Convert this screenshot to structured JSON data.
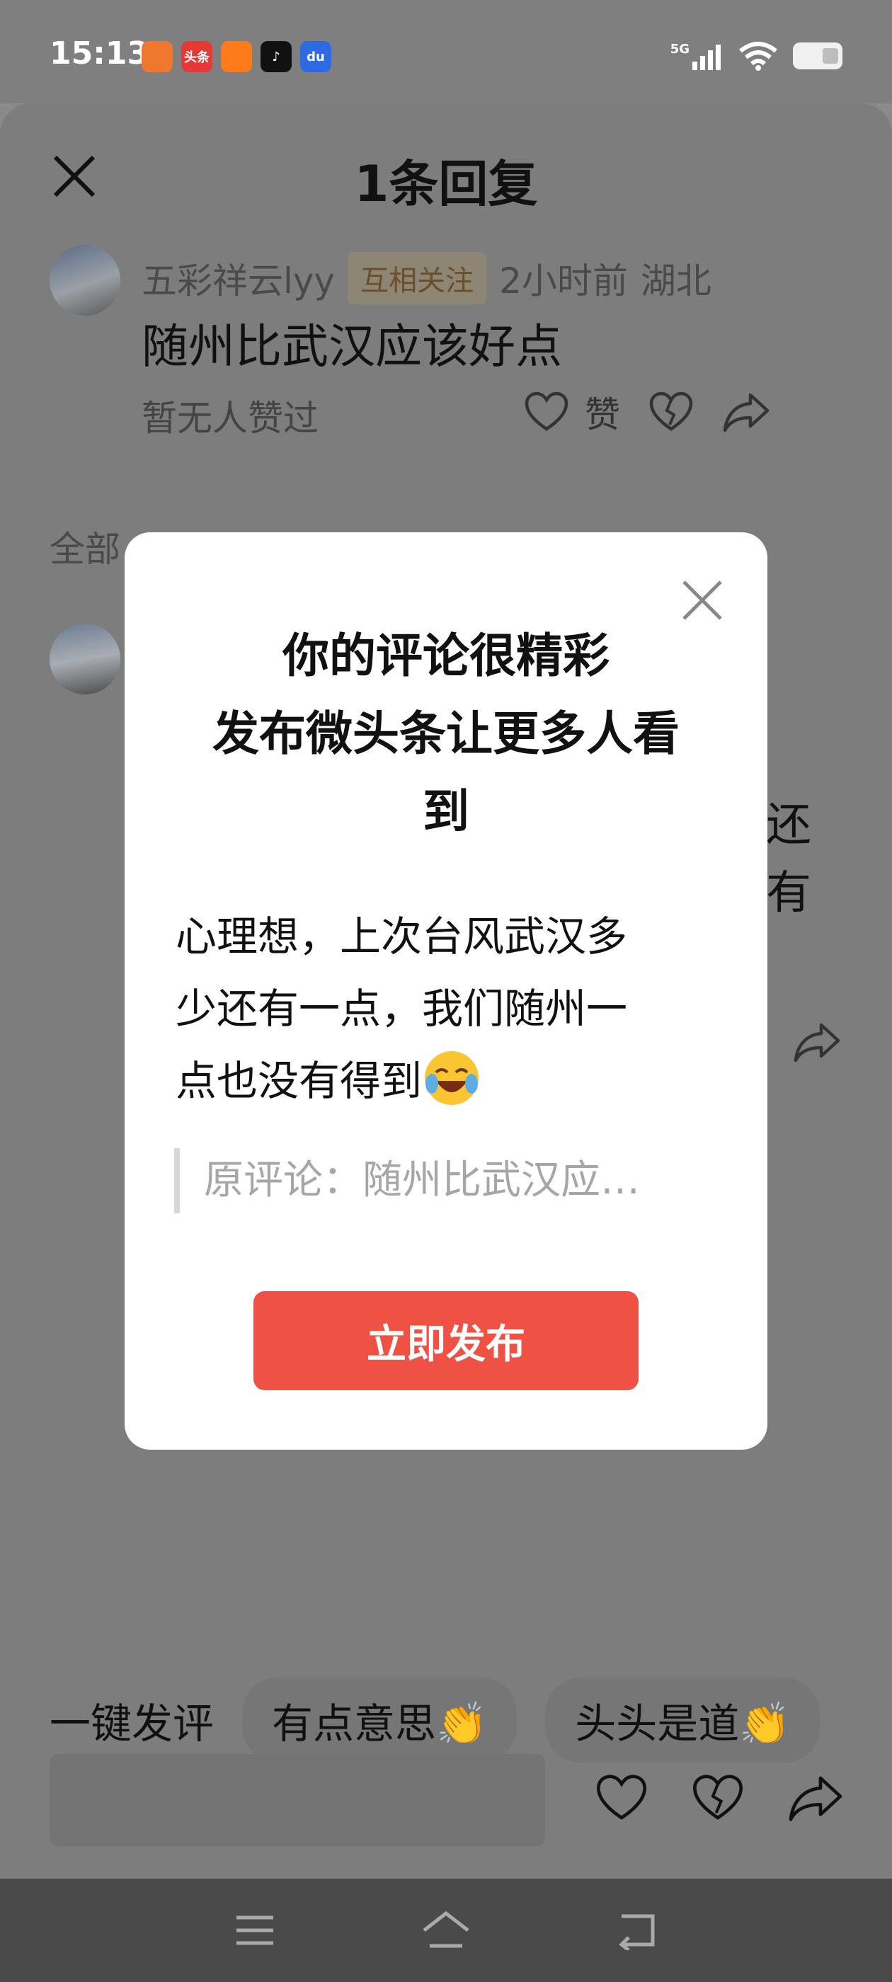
{
  "status_bar": {
    "time": "15:13",
    "network": "5G",
    "apps": [
      {
        "name": "game-app-icon",
        "label": "",
        "color": "#f0782e"
      },
      {
        "name": "toutiao-app-icon",
        "label": "头条",
        "color": "#e53935"
      },
      {
        "name": "kuaishou-app-icon",
        "label": "",
        "color": "#ff7a1a"
      },
      {
        "name": "douyin-app-icon",
        "label": "",
        "color": "#111111"
      },
      {
        "name": "baidu-app-icon",
        "label": "",
        "color": "#2f6ae5"
      }
    ]
  },
  "sheet": {
    "title": "1条回复",
    "comment": {
      "username": "五彩祥云lyy",
      "relationship_tag": "互相关注",
      "time_ago": "2小时前",
      "location": "湖北",
      "text": "随州比武汉应该好点",
      "likes_text": "暂无人赞过",
      "like_label": "赞"
    },
    "all_replies_label": "全部",
    "reply_fragment_line1": "还",
    "reply_fragment_line2": "有"
  },
  "modal": {
    "title_line1": "你的评论很精彩",
    "title_line2": "发布微头条让更多人看",
    "title_line3": "到",
    "body_line1": "心理想，上次台风武汉多",
    "body_line2": "少还有一点，我们随州一",
    "body_line3": "点也没有得到",
    "original_comment": "原评论：随州比武汉应…",
    "publish_label": "立即发布"
  },
  "quick_comment": {
    "label": "一键发评",
    "chips": [
      "有点意思👏",
      "头头是道👏"
    ]
  },
  "colors": {
    "accent": "#ef5245",
    "overlay": "#7d7d7d"
  }
}
